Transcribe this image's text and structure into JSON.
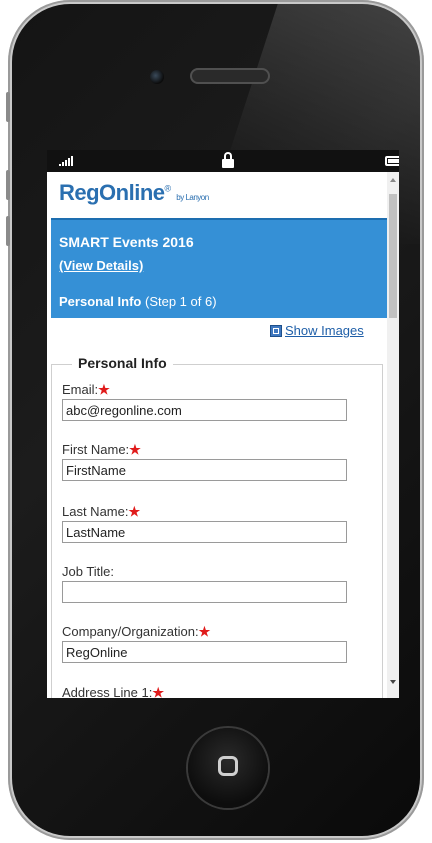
{
  "brand": {
    "name": "RegOnline",
    "mark": "®",
    "by": "by Lanyon"
  },
  "event": {
    "title": "SMART Events 2016",
    "view_details": "(View Details)",
    "step_label": "Personal Info",
    "step_count": "(Step 1 of 6)"
  },
  "toolbar": {
    "show_images": "Show Images"
  },
  "form": {
    "legend": "Personal Info",
    "required_mark": "★",
    "fields": [
      {
        "label": "Email:",
        "value": "abc@regonline.com"
      },
      {
        "label": "First Name:",
        "value": "FirstName"
      },
      {
        "label": "Last Name:",
        "value": "LastName"
      },
      {
        "label": "Job Title:",
        "value": ""
      },
      {
        "label": "Company/Organization:",
        "value": "RegOnline"
      },
      {
        "label": "Address Line 1:"
      }
    ]
  },
  "colors": {
    "header_bg": "#3590d6",
    "brand": "#2a6fb0",
    "required": "#e01b1b"
  }
}
